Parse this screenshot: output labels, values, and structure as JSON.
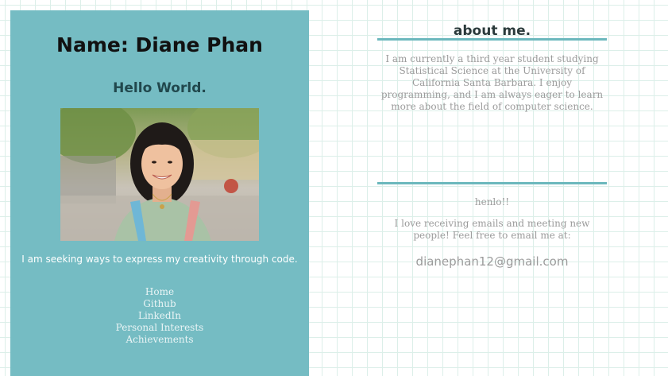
{
  "profile": {
    "name_heading": "Name: Diane Phan",
    "greeting": "Hello World.",
    "tagline": "I am seeking ways to express my creativity through code."
  },
  "nav": {
    "items": [
      {
        "label": "Home"
      },
      {
        "label": "Github"
      },
      {
        "label": "LinkedIn"
      },
      {
        "label": "Personal Interests"
      },
      {
        "label": "Achievements"
      }
    ]
  },
  "about": {
    "title": "about me.",
    "text": "I am currently a third year student studying Statistical Science at the University of California Santa Barbara. I enjoy programming, and I am always eager to learn more about the field of computer science."
  },
  "contact": {
    "greeting": "henlo!!",
    "text": "I love receiving emails and meeting new people! Feel free to email me at:",
    "email": "dianephan12@gmail.com"
  },
  "colors": {
    "sidebar_bg": "#75bcc3",
    "rule": "#6cb8bd",
    "grid_line": "#dcefe9",
    "muted_text": "#9b9b9b"
  }
}
